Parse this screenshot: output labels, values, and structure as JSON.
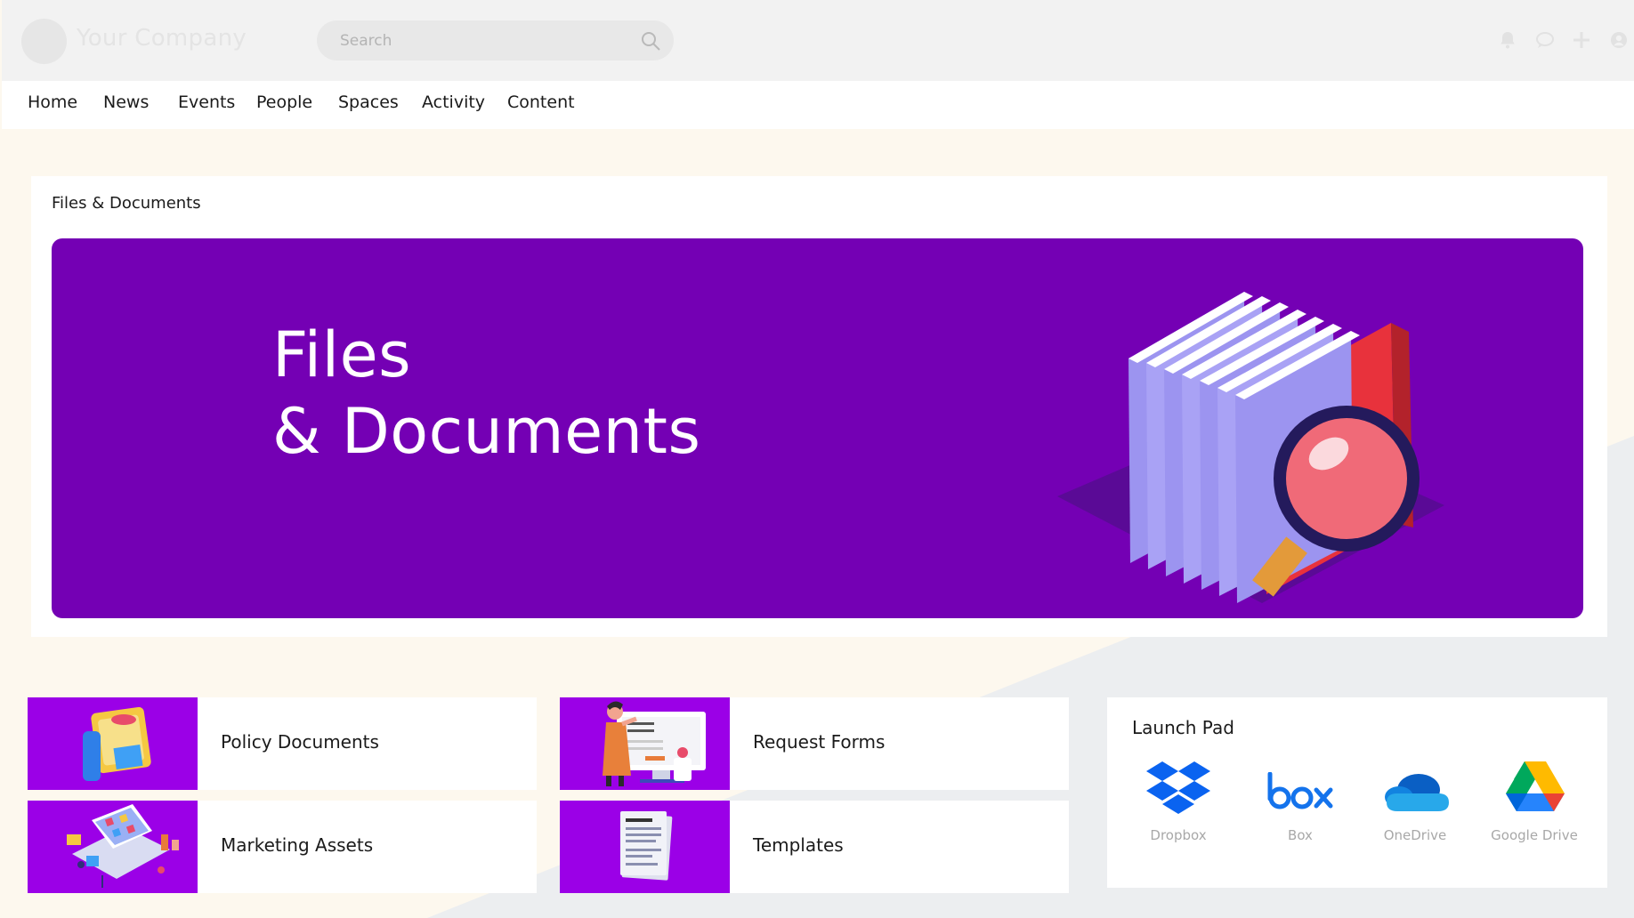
{
  "header": {
    "company_name": "Your Company",
    "search_placeholder": "Search",
    "icons": [
      "bell-icon",
      "chat-icon",
      "plus-icon",
      "user-icon"
    ]
  },
  "nav": {
    "items": [
      {
        "label": "Home"
      },
      {
        "label": "News"
      },
      {
        "label": "Events"
      },
      {
        "label": "People"
      },
      {
        "label": "Spaces"
      },
      {
        "label": "Activity"
      },
      {
        "label": "Content"
      }
    ]
  },
  "hero": {
    "section_title": "Files & Documents",
    "banner_line_1": "Files",
    "banner_line_2": "& Documents",
    "banner_color": "#7400b4"
  },
  "tiles": [
    {
      "label": "Policy Documents",
      "icon": "policy-documents-icon"
    },
    {
      "label": "Request Forms",
      "icon": "request-forms-icon"
    },
    {
      "label": "Marketing Assets",
      "icon": "marketing-assets-icon"
    },
    {
      "label": "Templates",
      "icon": "templates-icon"
    }
  ],
  "launchpad": {
    "title": "Launch Pad",
    "apps": [
      {
        "label": "Dropbox",
        "icon": "dropbox-icon"
      },
      {
        "label": "Box",
        "icon": "box-icon"
      },
      {
        "label": "OneDrive",
        "icon": "onedrive-icon"
      },
      {
        "label": "Google Drive",
        "icon": "google-drive-icon"
      }
    ]
  },
  "colors": {
    "accent_purple": "#9b00e7",
    "page_background": "#fdf8ee"
  }
}
